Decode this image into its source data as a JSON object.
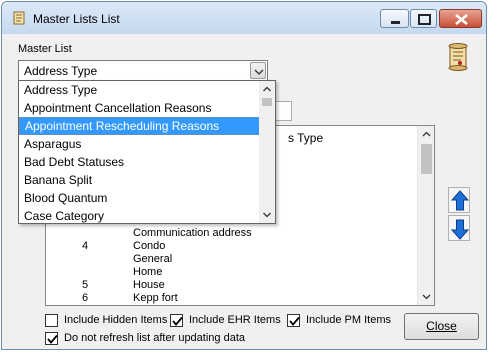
{
  "window": {
    "title": "Master Lists List"
  },
  "master_list": {
    "label": "Master List",
    "selected_value": "Address Type"
  },
  "dropdown": {
    "options": [
      "Address Type",
      "Appointment Cancellation Reasons",
      "Appointment Rescheduling Reasons",
      "Asparagus",
      "Bad Debt Statuses",
      "Banana Split",
      "Blood Quantum",
      "Case Category"
    ],
    "highlighted": "Appointment Rescheduling Reasons"
  },
  "list": {
    "header_fragment": "s Type",
    "rows": [
      {
        "num": "",
        "name": "Communication address"
      },
      {
        "num": "4",
        "name": "Condo"
      },
      {
        "num": "",
        "name": "General"
      },
      {
        "num": "",
        "name": "Home"
      },
      {
        "num": "5",
        "name": "House"
      },
      {
        "num": "6",
        "name": "Kepp fort"
      }
    ]
  },
  "checkboxes": {
    "include_hidden": {
      "label": "Include Hidden Items",
      "checked": false
    },
    "include_ehr": {
      "label": "Include EHR Items",
      "checked": true
    },
    "include_pm": {
      "label": "Include PM Items",
      "checked": true
    },
    "no_refresh": {
      "label": "Do not refresh list after updating data",
      "checked": true
    }
  },
  "buttons": {
    "close": "Close"
  },
  "colors": {
    "selection": "#3399ff",
    "arrow_blue": "#1e6fd9",
    "close_red": "#c74f35"
  }
}
